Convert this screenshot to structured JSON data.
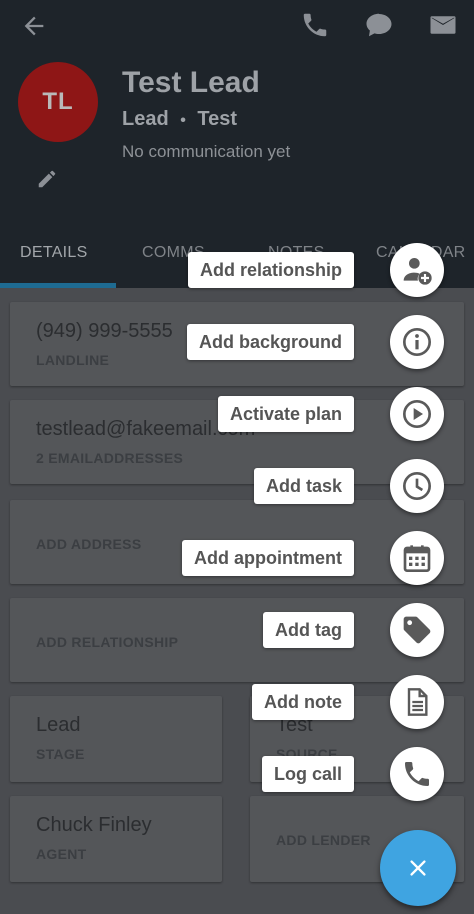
{
  "contact": {
    "initials": "TL",
    "name": "Test Lead",
    "type": "Lead",
    "separator": "•",
    "source": "Test",
    "communication_status": "No communication yet"
  },
  "tabs": [
    "DETAILS",
    "COMMS",
    "NOTES",
    "CALENDAR"
  ],
  "cards": {
    "phone": {
      "value": "(949) 999-5555",
      "label": "LANDLINE"
    },
    "email": {
      "value": "testlead@fakeemail.com",
      "label": "2 EMAILADDRESSES"
    },
    "address": {
      "label": "ADD ADDRESS"
    },
    "relationship": {
      "label": "ADD RELATIONSHIP"
    },
    "stage": {
      "value": "Lead",
      "label": "STAGE"
    },
    "source": {
      "value": "Test",
      "label": "SOURCE"
    },
    "agent": {
      "value": "Chuck Finley",
      "label": "AGENT"
    },
    "lender": {
      "label": "ADD LENDER"
    }
  },
  "speed_dial": [
    {
      "label": "Add relationship",
      "icon": "add-person-icon"
    },
    {
      "label": "Add background",
      "icon": "info-icon"
    },
    {
      "label": "Activate plan",
      "icon": "play-icon"
    },
    {
      "label": "Add task",
      "icon": "clock-icon"
    },
    {
      "label": "Add appointment",
      "icon": "calendar-icon"
    },
    {
      "label": "Add tag",
      "icon": "tag-icon"
    },
    {
      "label": "Add note",
      "icon": "document-icon"
    },
    {
      "label": "Log call",
      "icon": "phone-icon"
    }
  ],
  "fab_icon": "close-icon",
  "colors": {
    "fab": "#3fa4e1",
    "avatar": "#8e1616",
    "icon": "#5a5a5a"
  }
}
